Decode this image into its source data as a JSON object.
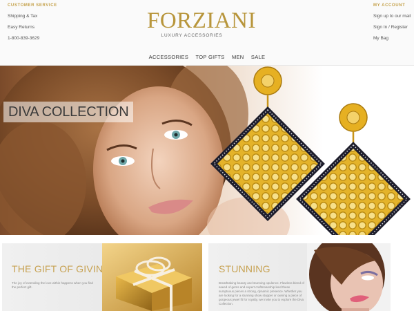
{
  "customer_service": {
    "title": "CUSTOMER SERVICE",
    "items": [
      "Shipping & Tax",
      "Easy Returns",
      "1-800-839-3629"
    ]
  },
  "account": {
    "title": "MY ACCOUNT",
    "items": [
      "Sign up to our mail",
      "Sign In / Register",
      "My Bag"
    ]
  },
  "brand": {
    "name": "FORZIANI",
    "tagline": "LUXURY ACCESSORIES"
  },
  "nav": [
    "ACCESSORIES",
    "TOP GIFTS",
    "MEN",
    "SALE"
  ],
  "hero": {
    "label": "DIVA COLLECTION"
  },
  "promos": [
    {
      "title": "THE GIFT OF GIVING",
      "text": "The joy of extending the love within happens when you find the perfect gift."
    },
    {
      "title": "STUNNING",
      "text": "Breathtaking beauty and stunning opulence. Flawless blend of saeed of gems and expert craftsmanship lend these sumptuous pieces a strong, dynamic presence. Whether you are looking for a stunning show stopper or owning a piece of gorgeous jewel fit for royalty, we invite you to explore the Diva Collection."
    }
  ],
  "colors": {
    "gold": "#c7a252",
    "brand": "#b8963c"
  }
}
